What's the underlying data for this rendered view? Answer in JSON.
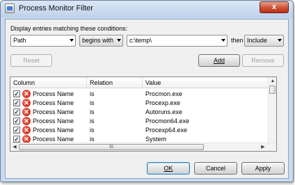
{
  "window": {
    "title": "Process Monitor Filter",
    "close_glyph": "x"
  },
  "condition": {
    "label": "Display entries matching these conditions:",
    "column_value": "Path",
    "relation_value": "begins with",
    "value_text": "c:\\temp\\",
    "then_label": "then",
    "action_value": "Include"
  },
  "buttons": {
    "reset": "Reset",
    "add": "Add",
    "remove": "Remove",
    "ok": "OK",
    "cancel": "Cancel",
    "apply": "Apply"
  },
  "list": {
    "columns": [
      "Column",
      "Relation",
      "Value"
    ],
    "rows": [
      {
        "column": "Process Name",
        "relation": "is",
        "value": "Procmon.exe",
        "checked": true
      },
      {
        "column": "Process Name",
        "relation": "is",
        "value": "Procexp.exe",
        "checked": true
      },
      {
        "column": "Process Name",
        "relation": "is",
        "value": "Autoruns.exe",
        "checked": true
      },
      {
        "column": "Process Name",
        "relation": "is",
        "value": "Procmon64.exe",
        "checked": true
      },
      {
        "column": "Process Name",
        "relation": "is",
        "value": "Procexp64.exe",
        "checked": true
      },
      {
        "column": "Process Name",
        "relation": "is",
        "value": "System",
        "checked": true
      }
    ],
    "check_glyph": "✓",
    "exclude_glyph": "✕",
    "scroll_grip": "III"
  },
  "icons": {
    "row_status": "exclude-x-icon",
    "app": "process-monitor-filter-icon"
  },
  "colors": {
    "title_bar": "#c9daf0",
    "close_button": "#d0573b",
    "exclude_icon": "#c4190a",
    "default_button_border": "#3c7fb1"
  }
}
